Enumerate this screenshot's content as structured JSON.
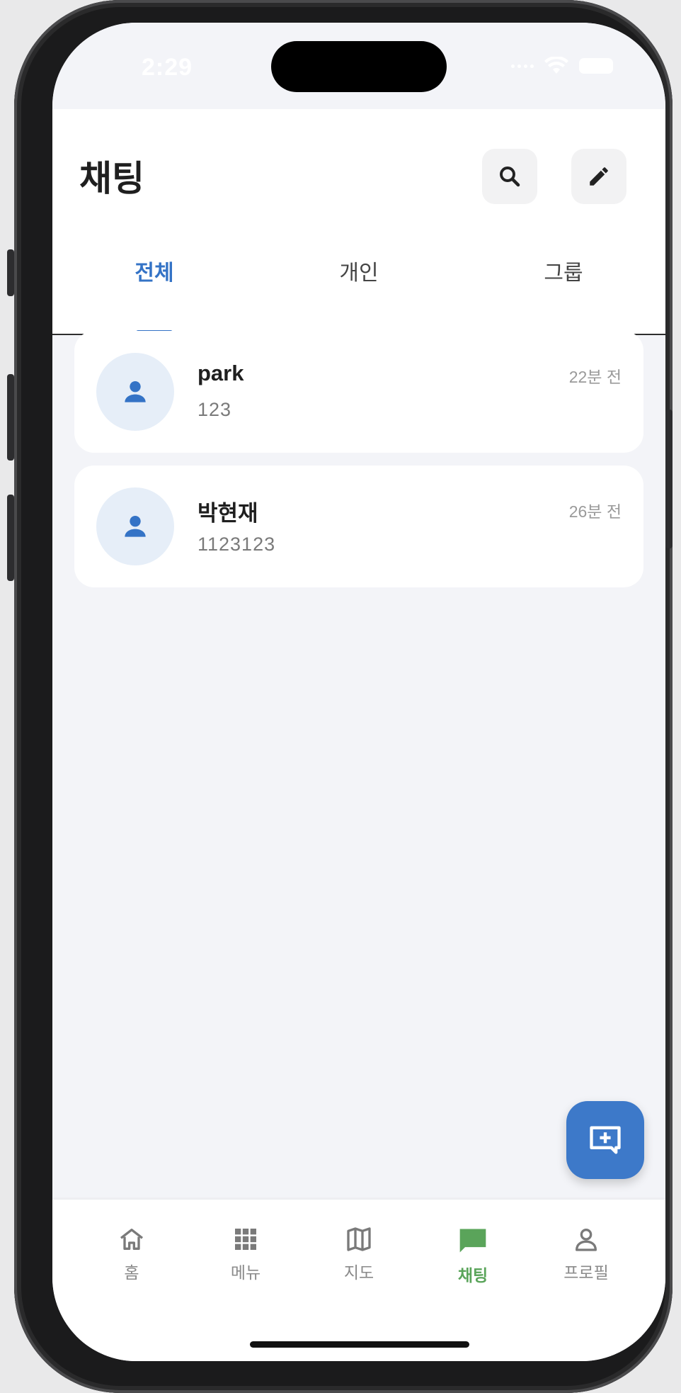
{
  "status_bar": {
    "time": "2:29"
  },
  "header": {
    "title": "채팅",
    "search_icon": "search-icon",
    "compose_icon": "pencil-icon"
  },
  "tabs": [
    {
      "label": "전체",
      "active": true
    },
    {
      "label": "개인",
      "active": false
    },
    {
      "label": "그룹",
      "active": false
    }
  ],
  "chats": [
    {
      "name": "park",
      "message": "123",
      "time": "22분 전",
      "avatar_icon": "person-icon"
    },
    {
      "name": "박현재",
      "message": "1123123",
      "time": "26분 전",
      "avatar_icon": "person-icon"
    }
  ],
  "fab": {
    "icon": "add-chat-icon"
  },
  "bottom_nav": [
    {
      "label": "홈",
      "icon": "home-icon",
      "active": false
    },
    {
      "label": "메뉴",
      "icon": "grid-icon",
      "active": false
    },
    {
      "label": "지도",
      "icon": "map-icon",
      "active": false
    },
    {
      "label": "채팅",
      "icon": "chat-icon",
      "active": true
    },
    {
      "label": "프로필",
      "icon": "profile-icon",
      "active": false
    }
  ],
  "colors": {
    "accent": "#3473c6",
    "active_nav": "#5aa45a",
    "background": "#f3f4f8",
    "fab": "#3d79c9"
  }
}
